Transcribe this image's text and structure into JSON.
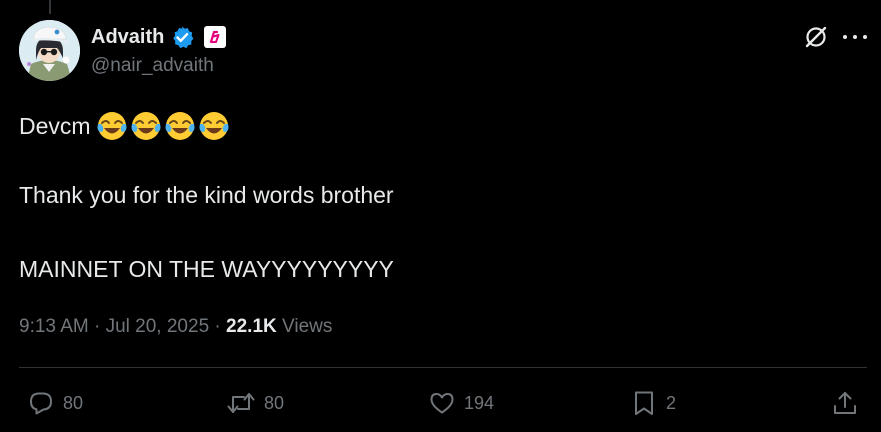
{
  "author": {
    "display_name": "Advaith",
    "handle": "@nair_advaith",
    "verified": true,
    "verified_color": "#1d9bf0",
    "affiliate_badge_color": "#e6007e"
  },
  "tweet": {
    "line1": "Devcm",
    "emoji": [
      "😂",
      "😂",
      "😂",
      "😂"
    ],
    "line2": "Thank you for the kind words brother",
    "line3": "MAINNET ON THE WAYYYYYYYYY"
  },
  "meta": {
    "time": "9:13 AM",
    "separator": " · ",
    "date": "Jul 20, 2025",
    "views_count": "22.1K",
    "views_label": "Views"
  },
  "actions": {
    "reply_count": "80",
    "retweet_count": "80",
    "like_count": "194",
    "bookmark_count": "2"
  },
  "icons": {
    "grok": "grok-icon",
    "more": "more-icon",
    "reply": "reply-icon",
    "retweet": "retweet-icon",
    "like": "heart-icon",
    "bookmark": "bookmark-icon",
    "share": "share-icon"
  },
  "colors": {
    "background": "#000000",
    "text_primary": "#e7e9ea",
    "text_secondary": "#71767b",
    "divider": "#2f3336"
  }
}
